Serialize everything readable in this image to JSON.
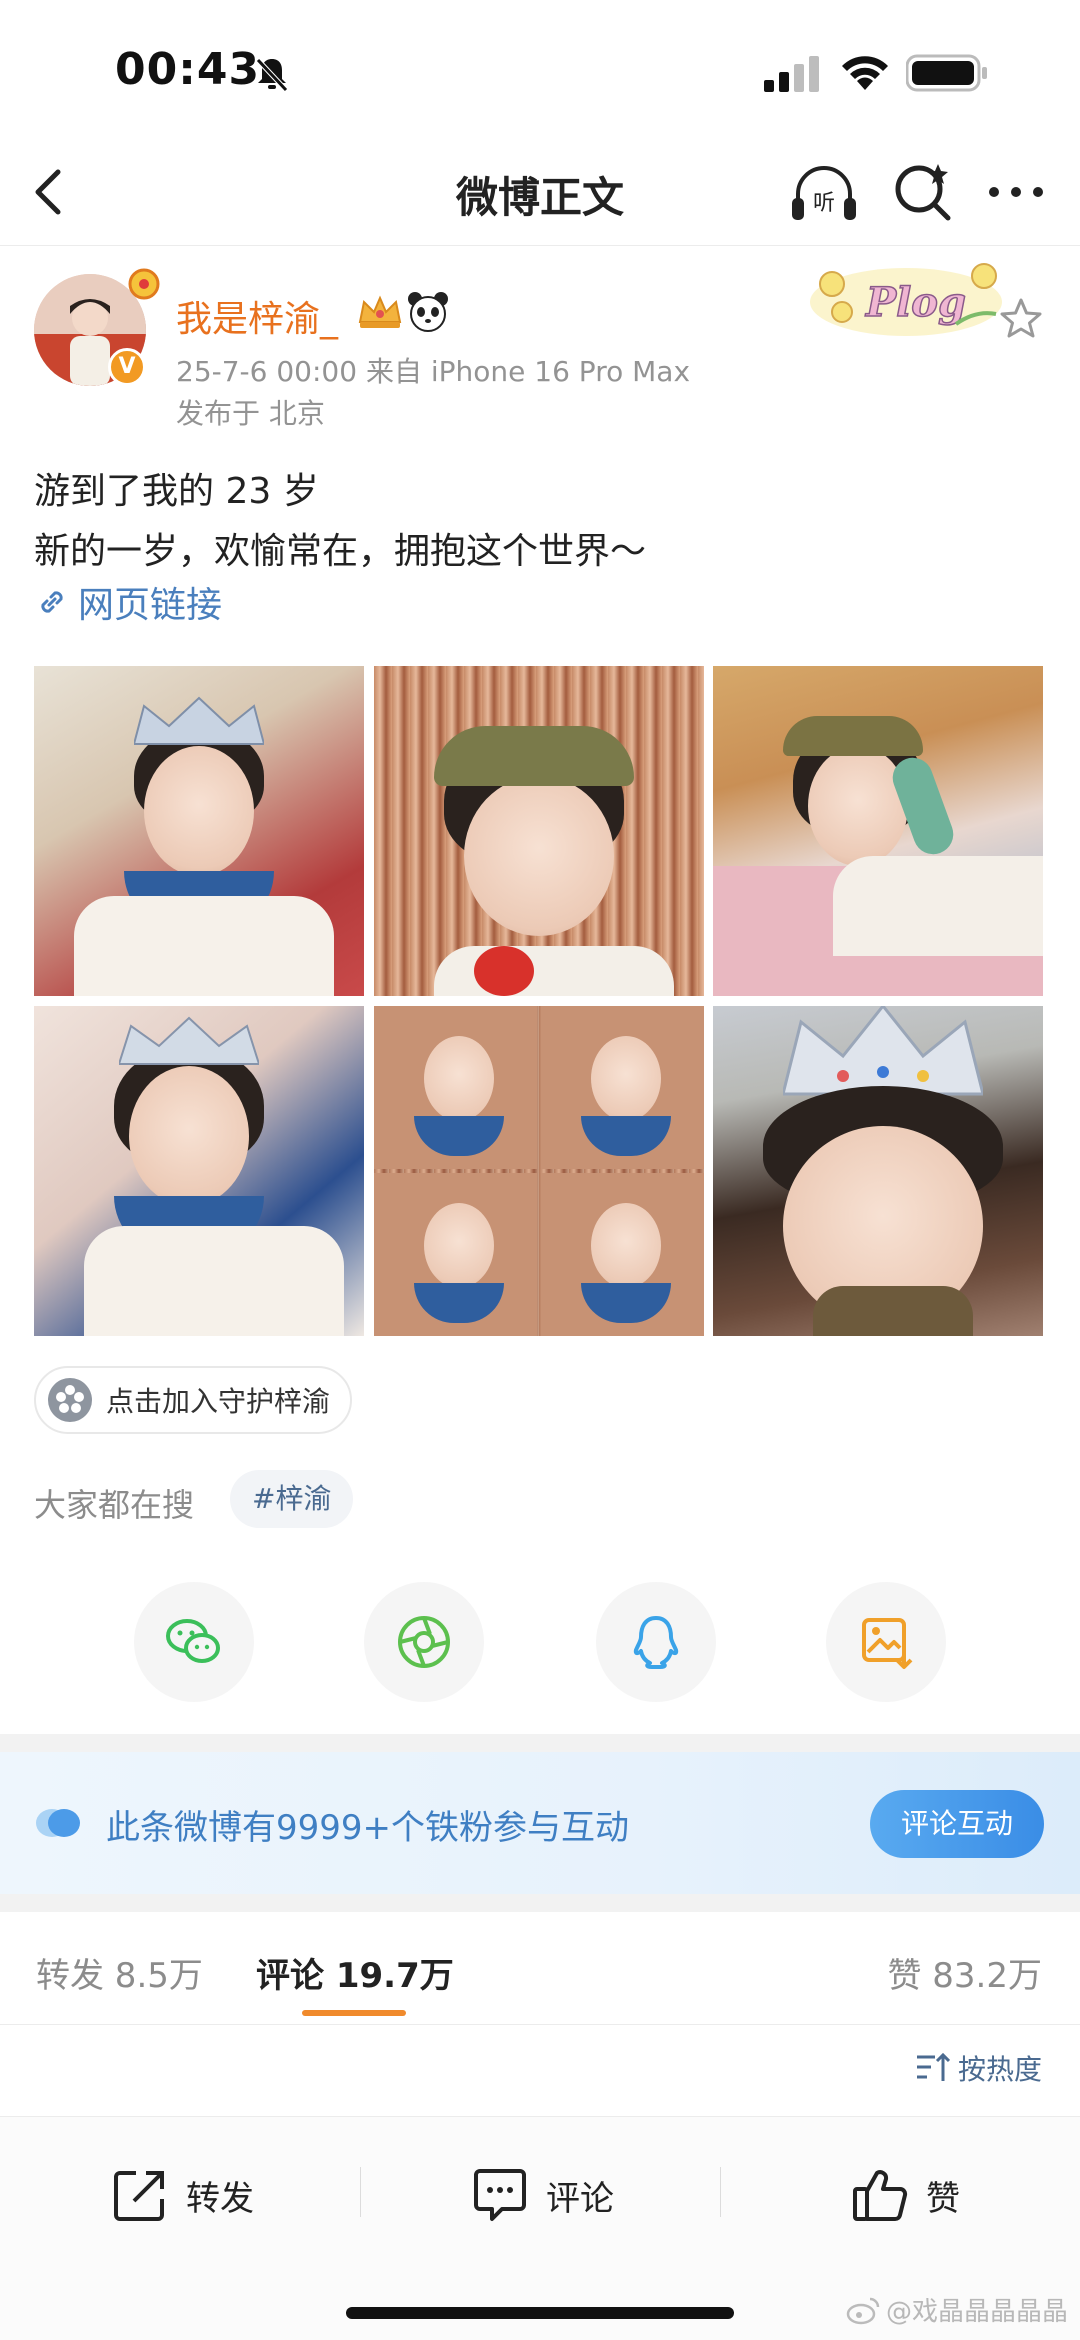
{
  "status_bar": {
    "time": "00:43"
  },
  "nav": {
    "title": "微博正文",
    "listen_label": "听"
  },
  "post": {
    "username": "我是梓渝_",
    "meta": "25-7-6 00:00  来自 iPhone 16 Pro Max",
    "location": "发布于 北京",
    "sticker_text": "Plog",
    "verified_mark": "V",
    "content_lines": [
      "游到了我的 23 岁",
      "新的一岁，欢愉常在，拥抱这个世界～"
    ],
    "link_text": "网页链接",
    "photo_count": 6
  },
  "guard_chip": {
    "label": "点击加入守护梓渝"
  },
  "trending": {
    "label": "大家都在搜",
    "tag": "#梓渝"
  },
  "share": {
    "items": [
      "wechat-icon",
      "moments-icon",
      "qq-icon",
      "save-image-icon"
    ]
  },
  "fan_banner": {
    "text": "此条微博有9999+个铁粉参与互动",
    "button": "评论互动"
  },
  "stats": {
    "repost": "转发 8.5万",
    "comment": "评论 19.7万",
    "like": "赞 83.2万",
    "active_tab": "comment"
  },
  "sort": {
    "label": "按热度"
  },
  "bottom_actions": {
    "repost": "转发",
    "comment": "评论",
    "like": "赞"
  },
  "watermark": "@戏晶晶晶晶晶",
  "colors": {
    "username": "#e8711e",
    "link": "#4a7fbd",
    "accent_underline": "#f08a2c",
    "banner_text": "#3f7fc3",
    "banner_button": "#3a8de6"
  }
}
